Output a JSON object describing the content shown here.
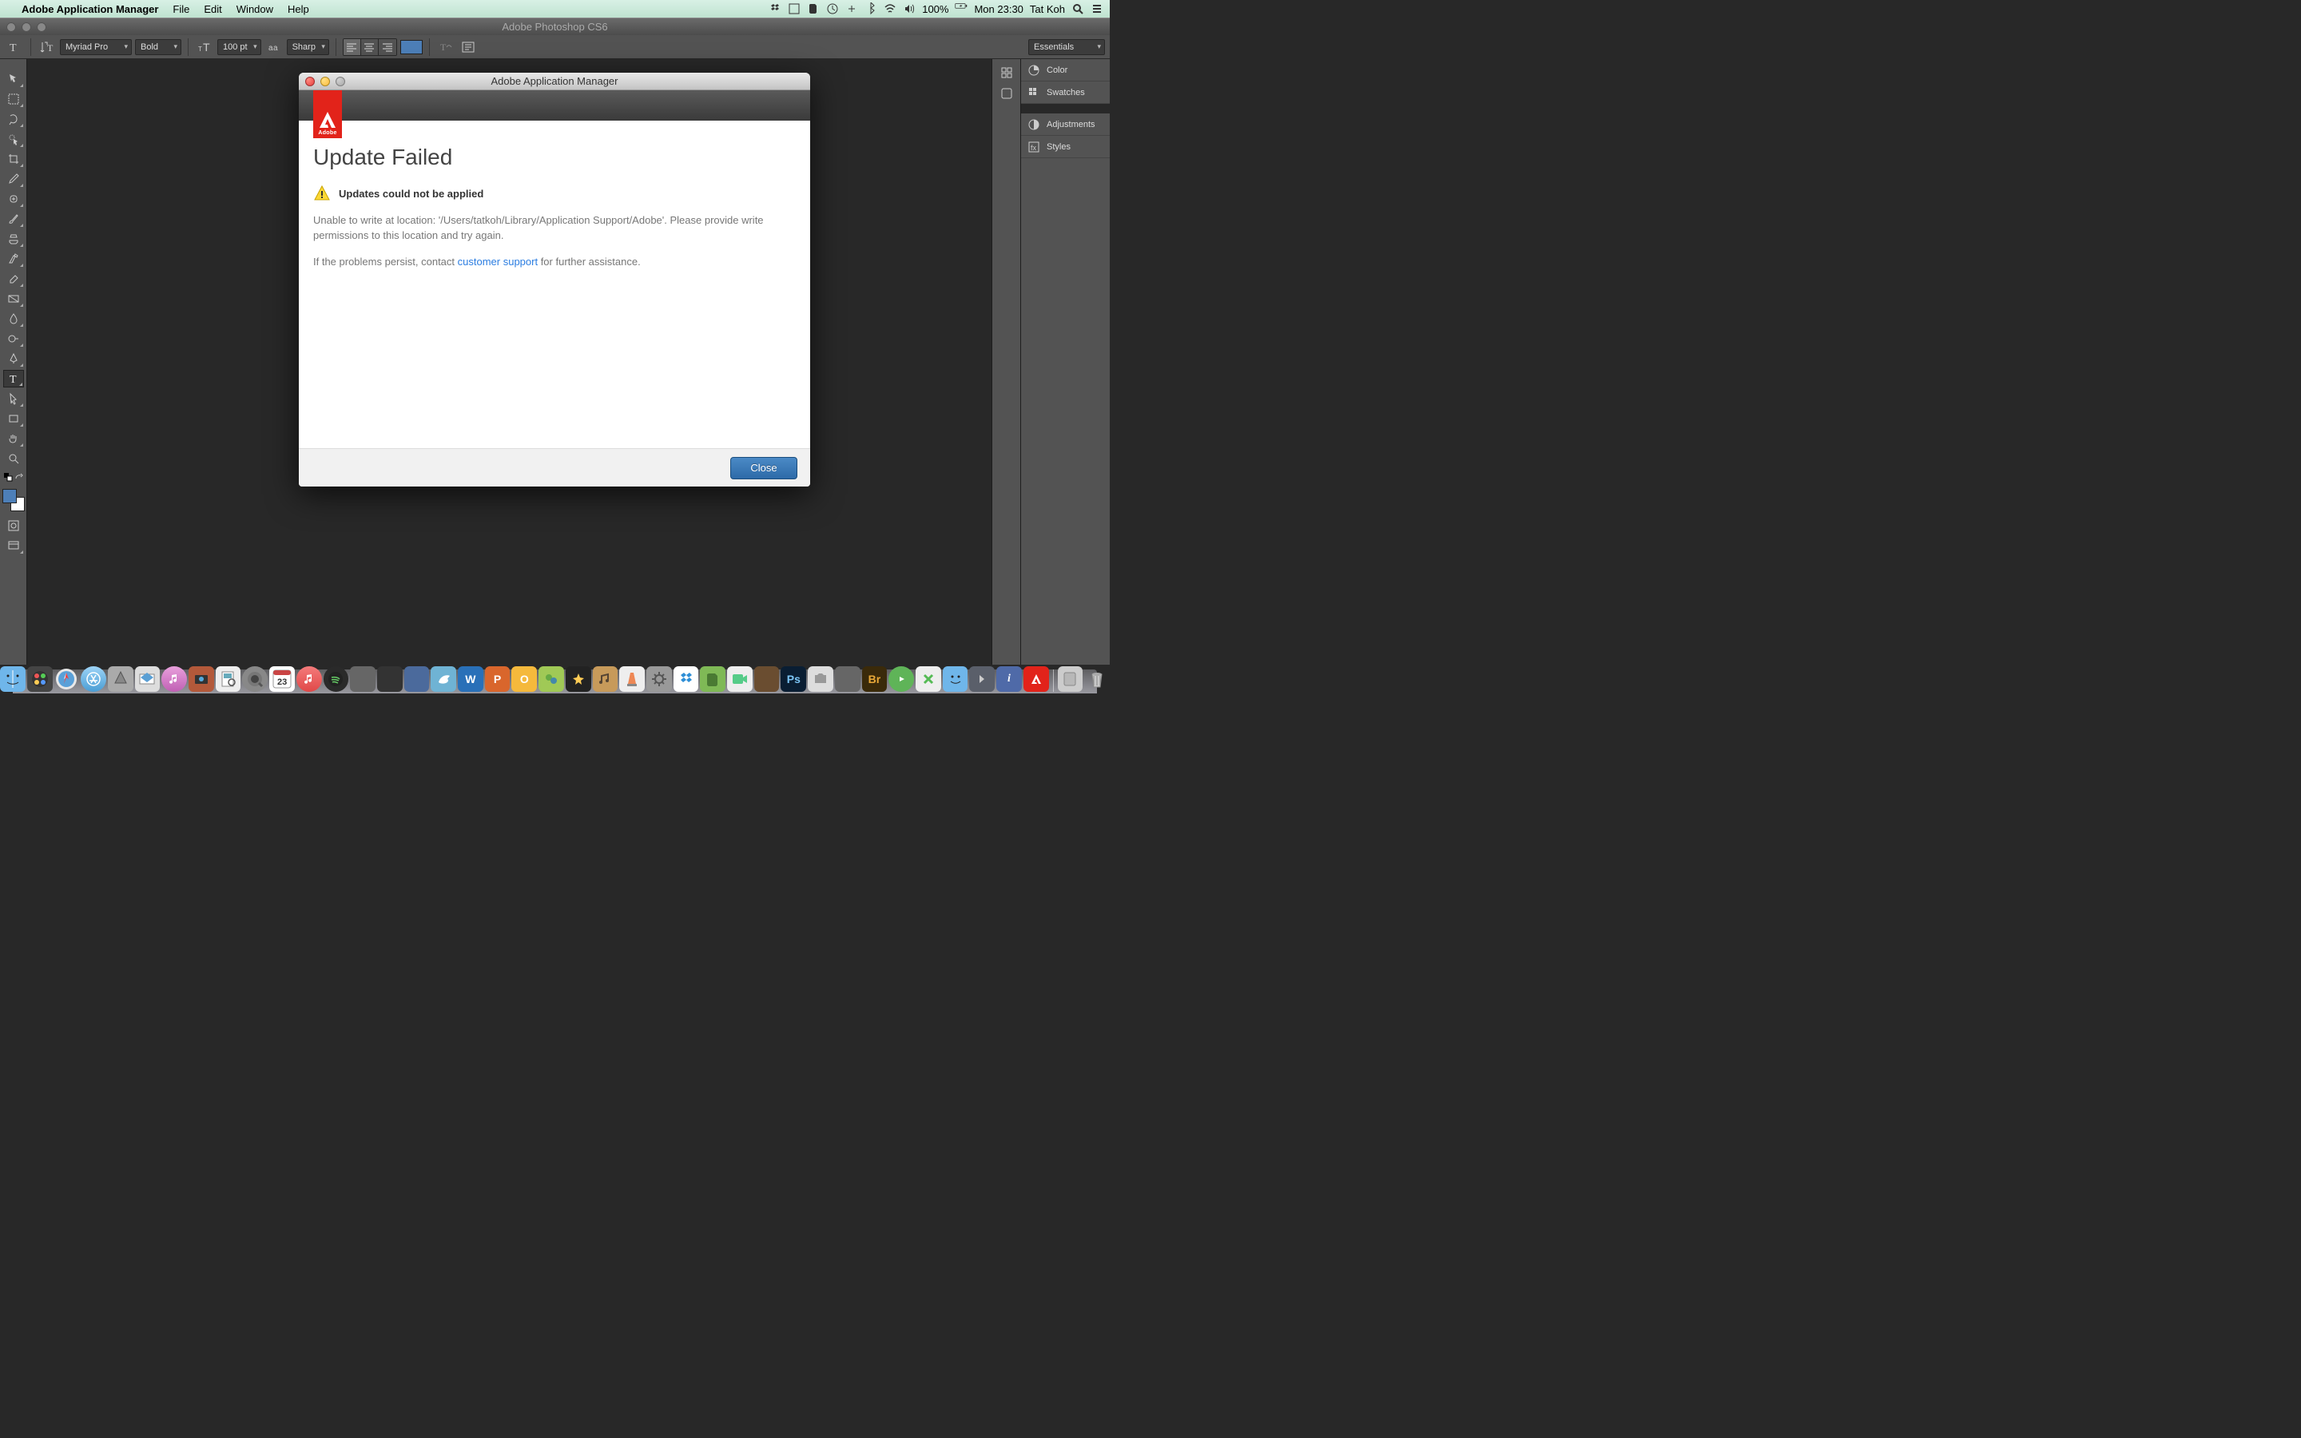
{
  "menubar": {
    "app_name": "Adobe Application Manager",
    "items": [
      "File",
      "Edit",
      "Window",
      "Help"
    ],
    "battery_pct": "100%",
    "clock": "Mon 23:30",
    "user": "Tat Koh"
  },
  "window": {
    "title": "Adobe Photoshop CS6"
  },
  "options_bar": {
    "font_family": "Myriad Pro",
    "font_style": "Bold",
    "font_size": "100 pt",
    "anti_alias": "Sharp",
    "text_color": "#4d7fb8",
    "workspace": "Essentials"
  },
  "tools": [
    "move-tool",
    "marquee-tool",
    "lasso-tool",
    "quick-select-tool",
    "crop-tool",
    "eyedropper-tool",
    "healing-brush-tool",
    "brush-tool",
    "clone-stamp-tool",
    "history-brush-tool",
    "eraser-tool",
    "gradient-tool",
    "blur-tool",
    "dodge-tool",
    "pen-tool",
    "type-tool",
    "path-select-tool",
    "rectangle-tool",
    "hand-tool",
    "zoom-tool"
  ],
  "colors": {
    "foreground": "#4d7fb8",
    "background": "#ffffff"
  },
  "panels": {
    "group1": [
      {
        "name": "color",
        "label": "Color"
      },
      {
        "name": "swatches",
        "label": "Swatches"
      }
    ],
    "group2": [
      {
        "name": "adjustments",
        "label": "Adjustments"
      },
      {
        "name": "styles",
        "label": "Styles"
      }
    ]
  },
  "dialog": {
    "window_title": "Adobe Application Manager",
    "adobe_word": "Adobe",
    "heading": "Update Failed",
    "warn_label": "Updates could not be applied",
    "body1": "Unable to write at location: '/Users/tatkoh/Library/Application Support/Adobe'. Please provide write permissions to this location and try again.",
    "body2_pre": "If the problems persist, contact ",
    "body2_link": "customer support",
    "body2_post": " for further assistance.",
    "close_label": "Close"
  },
  "dock": {
    "apps": [
      {
        "name": "finder",
        "bg": "#6fb6ea"
      },
      {
        "name": "dashboard",
        "bg": "#555"
      },
      {
        "name": "safari",
        "bg": "#e0e0e0"
      },
      {
        "name": "appstore",
        "bg": "#8cc9f5"
      },
      {
        "name": "launchpad",
        "bg": "#a0a0a0"
      },
      {
        "name": "mail",
        "bg": "#ccc"
      },
      {
        "name": "itunes-store",
        "bg": "#d98bd2"
      },
      {
        "name": "photobooth",
        "bg": "#b35a3a"
      },
      {
        "name": "preview",
        "bg": "#ddd"
      },
      {
        "name": "quicktime",
        "bg": "#999"
      },
      {
        "name": "ical",
        "bg": "#eee"
      },
      {
        "name": "itunes",
        "bg": "#e85d5d"
      },
      {
        "name": "spotify",
        "bg": "#3c3c3c"
      },
      {
        "name": "iconapp",
        "bg": "#666"
      },
      {
        "name": "pages",
        "bg": "#333"
      },
      {
        "name": "app1",
        "bg": "#4b6a9c"
      },
      {
        "name": "sparrow",
        "bg": "#6fb3d4"
      },
      {
        "name": "word",
        "bg": "#2970b8",
        "letter": "W"
      },
      {
        "name": "powerpoint",
        "bg": "#d9662c",
        "letter": "P"
      },
      {
        "name": "outlook",
        "bg": "#f5b93c",
        "letter": "O"
      },
      {
        "name": "messenger",
        "bg": "#a0c956"
      },
      {
        "name": "imovie",
        "bg": "#222"
      },
      {
        "name": "garageband",
        "bg": "#c79a5a"
      },
      {
        "name": "vlc",
        "bg": "#e8e8e8"
      },
      {
        "name": "systempref",
        "bg": "#999"
      },
      {
        "name": "dropbox",
        "bg": "#cde8f7"
      },
      {
        "name": "evernote",
        "bg": "#7fb956"
      },
      {
        "name": "facetime",
        "bg": "#ddd"
      },
      {
        "name": "minecraft",
        "bg": "#6a4d30"
      },
      {
        "name": "photoshop",
        "bg": "#0a1e33",
        "letter": "Ps"
      },
      {
        "name": "screenshot",
        "bg": "#ccc"
      },
      {
        "name": "mixer",
        "bg": "#666"
      },
      {
        "name": "bridge",
        "bg": "#3a2a0a",
        "letter": "Br"
      },
      {
        "name": "spotify2",
        "bg": "#5fb458"
      },
      {
        "name": "x",
        "bg": "#ccc"
      },
      {
        "name": "finder2",
        "bg": "#6fb6ea"
      },
      {
        "name": "shortcut",
        "bg": "#5a5f6a"
      },
      {
        "name": "info",
        "bg": "#4f6aa8",
        "letter": "i"
      },
      {
        "name": "adobe",
        "bg": "#e2231a"
      },
      {
        "name": "hdd",
        "bg": "#b8b8b8"
      },
      {
        "name": "trash",
        "bg": "#b8b8b8"
      }
    ]
  }
}
